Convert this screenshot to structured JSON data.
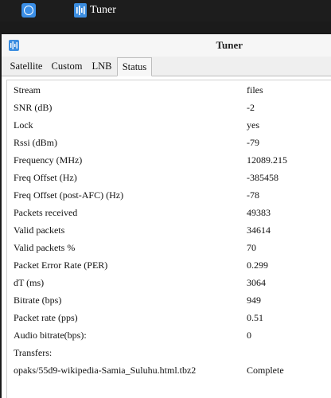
{
  "taskbar": {
    "app_title": "Tuner"
  },
  "window": {
    "title": "Tuner"
  },
  "tabs": [
    {
      "label": "Satellite"
    },
    {
      "label": "Custom"
    },
    {
      "label": "LNB"
    },
    {
      "label": "Status",
      "active": true
    }
  ],
  "status": {
    "rows": [
      {
        "label": "Stream",
        "value": "files"
      },
      {
        "label": "SNR (dB)",
        "value": "-2"
      },
      {
        "label": "Lock",
        "value": "yes"
      },
      {
        "label": "Rssi (dBm)",
        "value": "-79"
      },
      {
        "label": "Frequency (MHz)",
        "value": "12089.215"
      },
      {
        "label": "Freq Offset (Hz)",
        "value": "-385458"
      },
      {
        "label": "Freq Offset (post-AFC) (Hz)",
        "value": "-78"
      },
      {
        "label": "Packets received",
        "value": "49383"
      },
      {
        "label": "Valid packets",
        "value": "34614"
      },
      {
        "label": "Valid packets %",
        "value": "70"
      },
      {
        "label": "Packet Error Rate (PER)",
        "value": "0.299"
      },
      {
        "label": "dT (ms)",
        "value": "3064"
      },
      {
        "label": "Bitrate (bps)",
        "value": "949"
      },
      {
        "label": "Packet rate (pps)",
        "value": "0.51"
      },
      {
        "label": "Audio bitrate(bps):",
        "value": "0"
      },
      {
        "label": "Transfers:",
        "value": ""
      },
      {
        "label": "opaks/55d9-wikipedia-Samia_Suluhu.html.tbz2",
        "value": "Complete"
      }
    ]
  }
}
